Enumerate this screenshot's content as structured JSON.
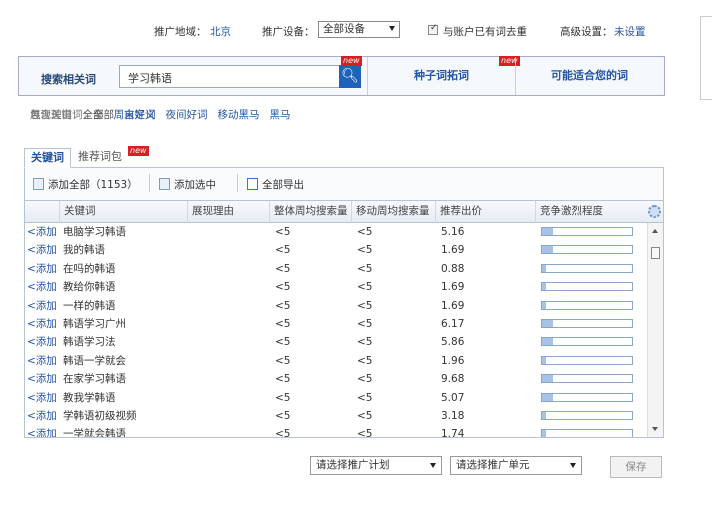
{
  "topbar": {
    "region_label": "推广地域：",
    "region_value": "北京",
    "device_label": "推广设备：",
    "device_value": "全部设备",
    "dedupe_label": "与账户已有词去重",
    "advanced_label": "高级设置：",
    "advanced_value": "未设置"
  },
  "search": {
    "label": "搜索相关词",
    "value": "学习韩语",
    "new_badge": "new",
    "seed_tab": "种子词拓词",
    "seed_badge": "new",
    "fit_tab": "可能适合您的词"
  },
  "filters": {
    "contains_label": "包含关键词：",
    "contains_all": "全部",
    "contains_custom": "自定义",
    "reason_label": "展现理由：",
    "reason_all": "全部",
    "reason_items": [
      "周末好词",
      "夜间好词",
      "移动黑马",
      "黑马"
    ]
  },
  "tabs": {
    "keywords": "关键词",
    "packages": "推荐词包",
    "packages_badge": "new"
  },
  "actions": {
    "add_all": "添加全部（1153）",
    "add_selected": "添加选中",
    "export_all": "全部导出"
  },
  "table": {
    "headers": [
      "关键词",
      "展现理由",
      "整体周均搜索量",
      "移动周均搜索量",
      "推荐出价",
      "竞争激烈程度"
    ],
    "add_label": "<添加",
    "rows": [
      {
        "keyword": "电脑学习韩语",
        "reason": "",
        "overall": "<5",
        "mobile": "<5",
        "bid": "5.16",
        "competition": 0.12
      },
      {
        "keyword": "我的韩语",
        "reason": "",
        "overall": "<5",
        "mobile": "<5",
        "bid": "1.69",
        "competition": 0.12
      },
      {
        "keyword": "在吗的韩语",
        "reason": "",
        "overall": "<5",
        "mobile": "<5",
        "bid": "0.88",
        "competition": 0.04
      },
      {
        "keyword": "教给你韩语",
        "reason": "",
        "overall": "<5",
        "mobile": "<5",
        "bid": "1.69",
        "competition": 0.04
      },
      {
        "keyword": "一样的韩语",
        "reason": "",
        "overall": "<5",
        "mobile": "<5",
        "bid": "1.69",
        "competition": 0.04
      },
      {
        "keyword": "韩语学习广州",
        "reason": "",
        "overall": "<5",
        "mobile": "<5",
        "bid": "6.17",
        "competition": 0.12
      },
      {
        "keyword": "韩语学习法",
        "reason": "",
        "overall": "<5",
        "mobile": "<5",
        "bid": "5.86",
        "competition": 0.12
      },
      {
        "keyword": "韩语一学就会",
        "reason": "",
        "overall": "<5",
        "mobile": "<5",
        "bid": "1.96",
        "competition": 0.04
      },
      {
        "keyword": "在家学习韩语",
        "reason": "",
        "overall": "<5",
        "mobile": "<5",
        "bid": "9.68",
        "competition": 0.12
      },
      {
        "keyword": "教我学韩语",
        "reason": "",
        "overall": "<5",
        "mobile": "<5",
        "bid": "5.07",
        "competition": 0.12
      },
      {
        "keyword": "学韩语初级视频",
        "reason": "",
        "overall": "<5",
        "mobile": "<5",
        "bid": "3.18",
        "competition": 0.04
      },
      {
        "keyword": "一学就会韩语",
        "reason": "",
        "overall": "<5",
        "mobile": "<5",
        "bid": "1.74",
        "competition": 0.04
      }
    ]
  },
  "bottom": {
    "plan_select": "请选择推广计划",
    "unit_select": "请选择推广单元",
    "save": "保存"
  }
}
